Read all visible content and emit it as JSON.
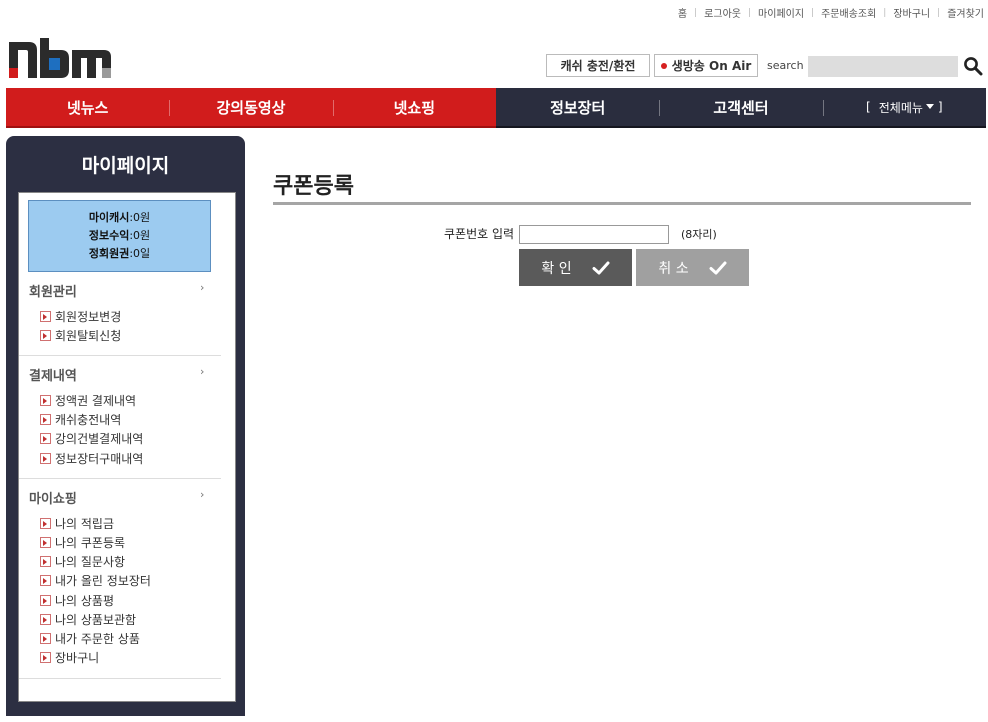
{
  "top_links": [
    "홈",
    "로그아웃",
    "마이페이지",
    "주문배송조회",
    "장바구니",
    "즐겨찾기"
  ],
  "header": {
    "cash_button": "캐쉬 충전/환전",
    "live_button": "생방송 On Air",
    "search_label": "search",
    "search_placeholder": ""
  },
  "nav": {
    "items": [
      "넷뉴스",
      "강의동영상",
      "넷쇼핑",
      "정보장터",
      "고객센터"
    ],
    "full_menu": "전체메뉴",
    "bracket_open": "[",
    "bracket_close": "]"
  },
  "sidebar": {
    "title": "마이페이지",
    "cash": {
      "cash_label": "마이캐시",
      "cash_value": ":0원",
      "revenue_label": "정보수익",
      "revenue_value": ":0원",
      "member_label": "정회원권",
      "member_value": ":0일"
    },
    "sections": [
      {
        "title": "회원관리",
        "arrow": "›",
        "items": [
          "회원정보변경",
          "회원탈퇴신청"
        ]
      },
      {
        "title": "결제내역",
        "arrow": "›",
        "items": [
          "정액권 결제내역",
          "캐쉬충전내역",
          "강의건별결제내역",
          "정보장터구매내역"
        ]
      },
      {
        "title": "마이쇼핑",
        "arrow": "›",
        "items": [
          "나의 적립금",
          "나의 쿠폰등록",
          "나의 질문사항",
          "내가 올린 정보장터",
          "나의 상품평",
          "나의 상품보관함",
          "내가 주문한 상품",
          "장바구니"
        ]
      }
    ]
  },
  "main": {
    "title": "쿠폰등록",
    "coupon_label": "쿠폰번호 입력",
    "coupon_value": "",
    "coupon_hint": "(8자리)",
    "confirm_label": "확 인",
    "cancel_label": "취 소"
  },
  "colors": {
    "nav_red": "#d11c1c",
    "nav_dark": "#2a2d3e",
    "cash_box": "#9ccbf0",
    "confirm_button": "#5a5a5a",
    "cancel_button": "#a0a0a0"
  }
}
